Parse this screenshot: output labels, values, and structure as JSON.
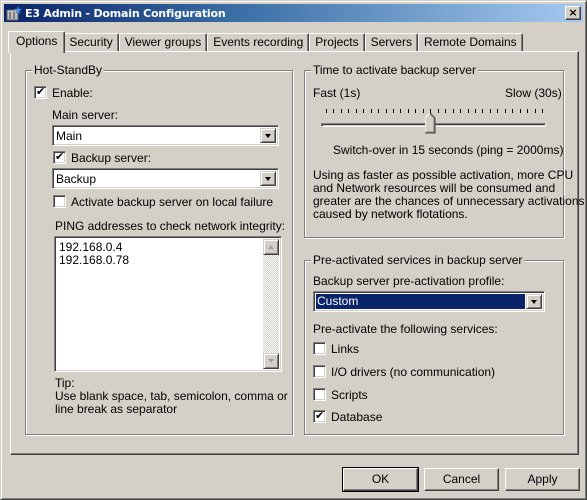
{
  "window": {
    "title": "E3 Admin - Domain Configuration",
    "close_label": "×"
  },
  "tabs": [
    {
      "label": "Options",
      "active": true
    },
    {
      "label": "Security"
    },
    {
      "label": "Viewer groups"
    },
    {
      "label": "Events recording"
    },
    {
      "label": "Projects"
    },
    {
      "label": "Servers"
    },
    {
      "label": "Remote Domains"
    }
  ],
  "hot_standby": {
    "legend": "Hot-StandBy",
    "enable_label": "Enable:",
    "enable_checked": true,
    "main_server_label": "Main server:",
    "main_server_value": "Main",
    "backup_server_label": "Backup server:",
    "backup_server_checked": true,
    "backup_server_value": "Backup",
    "activate_on_failure_label": "Activate backup server on local failure",
    "activate_on_failure_checked": false,
    "ping_label": "PING addresses to check network integrity:",
    "ping_addresses": [
      "192.168.0.4",
      "192.168.0.78"
    ],
    "tip_title": "Tip:",
    "tip_line1": "Use blank space, tab, semicolon, comma or",
    "tip_line2": "line break as separator"
  },
  "activation_time": {
    "legend": "Time to activate backup server",
    "fast_label": "Fast (1s)",
    "slow_label": "Slow (30s)",
    "slider_min": 1,
    "slider_max": 30,
    "slider_value": 15,
    "status": "Switch-over in 15 seconds (ping = 2000ms)",
    "note_lines": [
      "Using as faster as possible activation, more CPU",
      "and Network resources will be consumed and",
      "greater are the chances of unnecessary activations",
      "caused by network flotations."
    ]
  },
  "preactivated": {
    "legend": "Pre-activated services in backup server",
    "profile_label": "Backup server pre-activation profile:",
    "profile_value": "Custom",
    "services_label": "Pre-activate the following services:",
    "services": [
      {
        "label": "Links",
        "checked": false
      },
      {
        "label": "I/O drivers (no communication)",
        "checked": false
      },
      {
        "label": "Scripts",
        "checked": false
      },
      {
        "label": "Database",
        "checked": true
      }
    ]
  },
  "buttons": {
    "ok": "OK",
    "cancel": "Cancel",
    "apply": "Apply"
  },
  "colors": {
    "title_gradient_start": "#0a246a",
    "title_gradient_end": "#a6caf0",
    "face": "#d4d0c8",
    "selection": "#0a246a"
  },
  "check_glyph": "✔"
}
